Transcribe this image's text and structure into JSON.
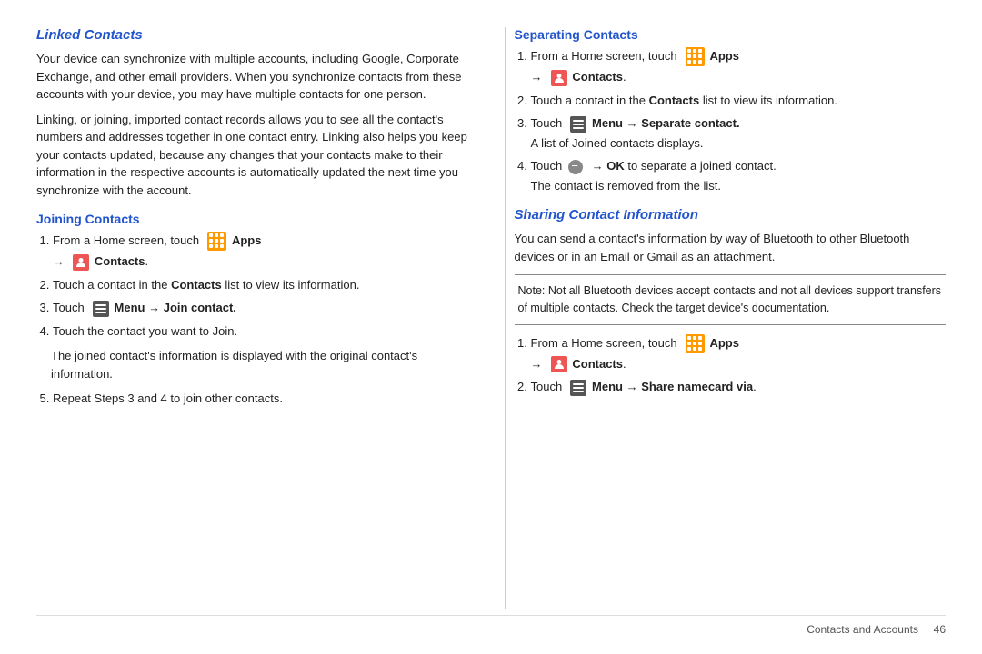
{
  "left": {
    "linked_title": "Linked Contacts",
    "linked_para1": "Your device can synchronize with multiple accounts, including Google, Corporate Exchange, and other email providers. When you synchronize contacts from these accounts with your device, you may have multiple contacts for one person.",
    "linked_para2": "Linking, or joining, imported contact records allows you to see all the contact's numbers and addresses together in one contact entry. Linking also helps you keep your contacts updated, because any changes that your contacts make to their information in the respective accounts is automatically updated the next time you synchronize with the account.",
    "joining_title": "Joining Contacts",
    "joining_steps": [
      "From a Home screen, touch  Apps →  Contacts.",
      "Touch a contact in the Contacts list to view its information.",
      "Touch  Menu → Join contact.",
      "Touch the contact you want to Join.",
      "Repeat Steps 3 and 4 to join other contacts."
    ],
    "joined_note": "The joined contact's information is displayed with the original contact's information.",
    "repeat_step": "Repeat Steps 3 and 4 to join other contacts."
  },
  "right": {
    "separating_title": "Separating Contacts",
    "separating_steps": [
      "From a Home screen, touch  Apps →  Contacts.",
      "Touch a contact in the Contacts list to view its information.",
      "Touch  Menu → Separate contact.",
      "Touch  → OK to separate a joined contact."
    ],
    "joined_list_note": "A list of Joined contacts displays.",
    "removed_note": "The contact is removed from the list.",
    "sharing_title": "Sharing Contact Information",
    "sharing_para": "You can send a contact's information by way of Bluetooth to other Bluetooth devices or in an Email or Gmail as an attachment.",
    "note_text": "Note: Not all Bluetooth devices accept contacts and not all devices support transfers of multiple contacts. Check the target device's documentation.",
    "sharing_steps": [
      "From a Home screen, touch  Apps →  Contacts.",
      "Touch  Menu → Share namecard via."
    ]
  },
  "footer": {
    "text": "Contacts and Accounts",
    "page": "46"
  }
}
